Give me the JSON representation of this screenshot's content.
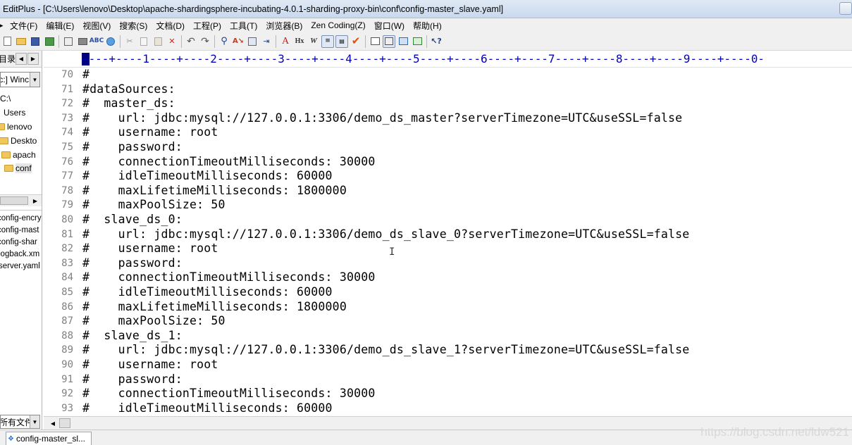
{
  "window": {
    "title": "EditPlus - [C:\\Users\\lenovo\\Desktop\\apache-shardingsphere-incubating-4.0.1-sharding-proxy-bin\\conf\\config-master_slave.yaml]"
  },
  "menu": {
    "items": [
      "文件(F)",
      "编辑(E)",
      "视图(V)",
      "搜索(S)",
      "文档(D)",
      "工程(P)",
      "工具(T)",
      "浏览器(B)",
      "Zen Coding(Z)",
      "窗口(W)",
      "帮助(H)"
    ]
  },
  "toolbar": {
    "icons": [
      "new-file-icon",
      "open-folder-icon",
      "save-icon",
      "save-all-icon",
      "print-preview-icon",
      "print-icon",
      "spell-check-icon",
      "browser-icon",
      "cut-icon",
      "copy-icon",
      "paste-icon",
      "delete-icon",
      "undo-icon",
      "redo-icon",
      "find-icon",
      "replace-icon",
      "find-in-files-icon",
      "goto-icon",
      "font-icon",
      "hex-icon",
      "word-wrap-icon",
      "line-number-icon",
      "column-icon",
      "check-icon",
      "window-icon",
      "panel-icon",
      "fullscreen-icon",
      "cliptext-icon",
      "help-icon"
    ]
  },
  "left_panel": {
    "header_label": "目录",
    "drive": "[c:] Winc",
    "tree": [
      {
        "label": "C:\\",
        "folder": false
      },
      {
        "label": "Users",
        "folder": false
      },
      {
        "label": "lenovo",
        "folder": true
      },
      {
        "label": "Deskto",
        "folder": true
      },
      {
        "label": "apach",
        "folder": true
      },
      {
        "label": "conf",
        "folder": true
      }
    ],
    "files": [
      "config-encry",
      "config-mast",
      "config-shar",
      "logback.xm",
      "server.yaml"
    ],
    "filter": "所有文件"
  },
  "ruler": {
    "text": "----+----1----+----2----+----3----+----4----+----5----+----6----+----7----+----8----+----9----+----0-"
  },
  "editor": {
    "lines": [
      {
        "n": "70",
        "t": "#"
      },
      {
        "n": "71",
        "t": "#dataSources:"
      },
      {
        "n": "72",
        "t": "#  master_ds:"
      },
      {
        "n": "73",
        "t": "#    url: jdbc:mysql://127.0.0.1:3306/demo_ds_master?serverTimezone=UTC&useSSL=false"
      },
      {
        "n": "74",
        "t": "#    username: root"
      },
      {
        "n": "75",
        "t": "#    password:"
      },
      {
        "n": "76",
        "t": "#    connectionTimeoutMilliseconds: 30000"
      },
      {
        "n": "77",
        "t": "#    idleTimeoutMilliseconds: 60000"
      },
      {
        "n": "78",
        "t": "#    maxLifetimeMilliseconds: 1800000"
      },
      {
        "n": "79",
        "t": "#    maxPoolSize: 50"
      },
      {
        "n": "80",
        "t": "#  slave_ds_0:"
      },
      {
        "n": "81",
        "t": "#    url: jdbc:mysql://127.0.0.1:3306/demo_ds_slave_0?serverTimezone=UTC&useSSL=false"
      },
      {
        "n": "82",
        "t": "#    username: root"
      },
      {
        "n": "83",
        "t": "#    password:"
      },
      {
        "n": "84",
        "t": "#    connectionTimeoutMilliseconds: 30000"
      },
      {
        "n": "85",
        "t": "#    idleTimeoutMilliseconds: 60000"
      },
      {
        "n": "86",
        "t": "#    maxLifetimeMilliseconds: 1800000"
      },
      {
        "n": "87",
        "t": "#    maxPoolSize: 50"
      },
      {
        "n": "88",
        "t": "#  slave_ds_1:"
      },
      {
        "n": "89",
        "t": "#    url: jdbc:mysql://127.0.0.1:3306/demo_ds_slave_1?serverTimezone=UTC&useSSL=false"
      },
      {
        "n": "90",
        "t": "#    username: root"
      },
      {
        "n": "91",
        "t": "#    password:"
      },
      {
        "n": "92",
        "t": "#    connectionTimeoutMilliseconds: 30000"
      },
      {
        "n": "93",
        "t": "#    idleTimeoutMilliseconds: 60000"
      }
    ]
  },
  "tabs": {
    "active": "config-master_sl..."
  },
  "watermark": "https://blog.csdn.net/ldw521"
}
